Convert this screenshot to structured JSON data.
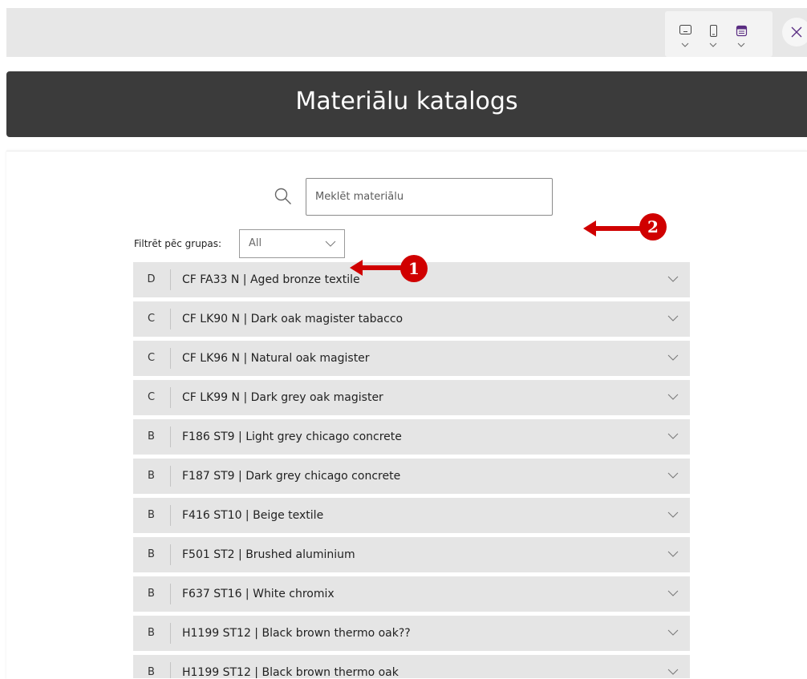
{
  "app": {
    "title": "Materiālu katalogs"
  },
  "toolbar": {
    "device_buttons": [
      {
        "name": "tablet-view",
        "icon": "tablet-landscape-icon"
      },
      {
        "name": "phone-view",
        "icon": "phone-icon"
      },
      {
        "name": "web-view",
        "icon": "browser-window-icon"
      }
    ],
    "close_icon": "close-icon"
  },
  "search": {
    "placeholder": "Meklēt materiālu",
    "value": ""
  },
  "filter": {
    "label": "Filtrēt pēc grupas:",
    "selected": "All"
  },
  "materials": [
    {
      "group": "D",
      "name": "CF FA33 N | Aged bronze textile"
    },
    {
      "group": "C",
      "name": "CF LK90 N | Dark oak magister tabacco"
    },
    {
      "group": "C",
      "name": "CF LK96 N | Natural oak magister"
    },
    {
      "group": "C",
      "name": "CF LK99 N | Dark grey oak magister"
    },
    {
      "group": "B",
      "name": "F186 ST9 | Light grey chicago concrete"
    },
    {
      "group": "B",
      "name": "F187 ST9 | Dark grey chicago concrete"
    },
    {
      "group": "B",
      "name": "F416 ST10 | Beige textile"
    },
    {
      "group": "B",
      "name": "F501 ST2 | Brushed aluminium"
    },
    {
      "group": "B",
      "name": "F637 ST16 | White chromix"
    },
    {
      "group": "B",
      "name": "H1199 ST12 | Black brown thermo oak??"
    },
    {
      "group": "B",
      "name": "H1199 ST12 | Black brown thermo oak"
    }
  ],
  "annotations": [
    {
      "label": "1"
    },
    {
      "label": "2"
    }
  ],
  "colors": {
    "header_bg": "#3b3b3b",
    "row_bg": "#e5e5e5",
    "annotation": "#d00000"
  }
}
